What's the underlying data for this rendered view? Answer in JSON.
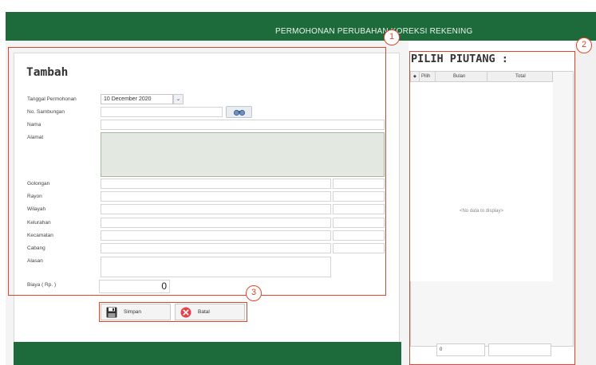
{
  "header": {
    "title": "PERMOHONAN PERUBAHAN KOREKSI REKENING"
  },
  "form": {
    "heading": "Tambah",
    "labels": {
      "tanggal": "Tanggal Permohonan",
      "sambungan": "No. Sambungan",
      "nama": "Nama",
      "alamat": "Alamat",
      "golongan": "Golongan",
      "rayon": "Rayon",
      "wilayah": "Wilayah",
      "kelurahan": "Kelurahan",
      "kecamatan": "Kecamatan",
      "cabang": "Cabang",
      "alasan": "Alasan",
      "biaya": "Biaya ( Rp. )"
    },
    "values": {
      "tanggal": "10 December 2020",
      "biaya": "0"
    }
  },
  "buttons": {
    "save": "Simpan",
    "cancel": "Batal"
  },
  "piutang": {
    "title": "PILIH PIUTANG :",
    "columns": [
      "Pilih",
      "Bulan",
      "Total"
    ],
    "empty_text": "<No data to display>",
    "footer_count": "0"
  },
  "annotations": {
    "badge1": "1",
    "badge2": "2",
    "badge3": "3"
  },
  "colors": {
    "brand_green": "#1d6b3a",
    "callout_red": "#e2442b"
  },
  "icons": [
    "binoculars-icon",
    "floppy-disk-icon",
    "cancel-x-icon",
    "chevron-down-icon"
  ]
}
